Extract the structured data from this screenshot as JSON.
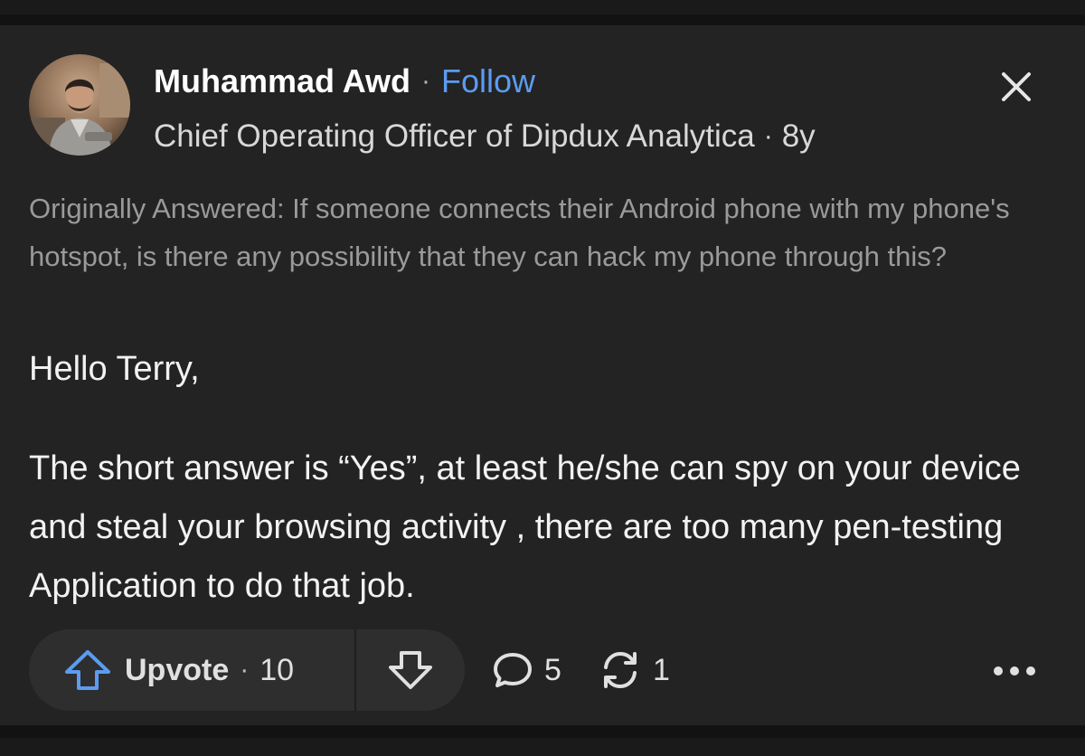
{
  "author": {
    "name": "Muhammad Awd",
    "follow_label": "Follow",
    "credential": "Chief Operating Officer of Dipdux Analytica",
    "age": "8y",
    "separator": "·"
  },
  "question": {
    "text": "Originally Answered: If someone connects their Android phone with my phone's hotspot, is there any possibility that they can hack my phone through this?"
  },
  "answer": {
    "greeting": "Hello Terry,",
    "paragraph": "The short answer is “Yes”, at least he/she can spy on your device and steal your browsing activity , there are too many pen-testing Application to do that job."
  },
  "actions": {
    "upvote_label": "Upvote",
    "separator": "·",
    "upvote_count": "10",
    "comment_count": "5",
    "share_count": "1"
  },
  "colors": {
    "background": "#121212",
    "card": "#232323",
    "accent_link": "#5b9cf0",
    "upvote_icon": "#5b9cf0"
  },
  "icons": [
    "avatar-photo",
    "close-icon",
    "upvote-arrow-icon",
    "downvote-arrow-icon",
    "comment-icon",
    "share-icon",
    "more-icon"
  ]
}
